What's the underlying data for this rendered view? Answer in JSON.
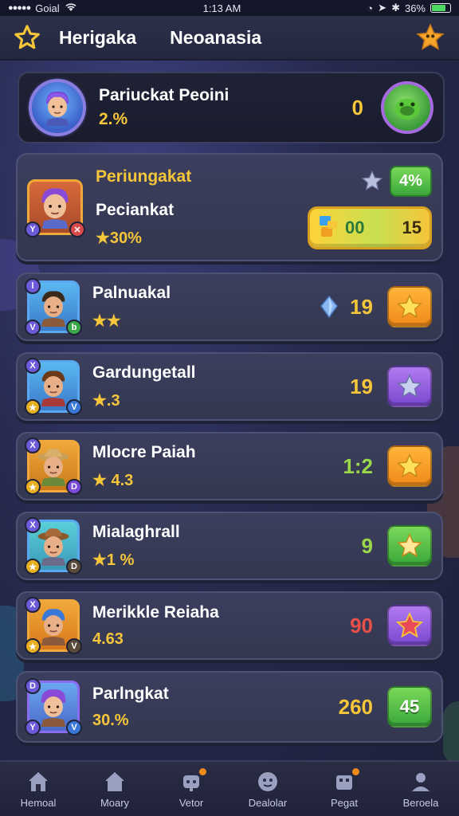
{
  "status_bar": {
    "carrier": "Goial",
    "time": "1:13 AM",
    "battery": "36%"
  },
  "header": {
    "title": "Herigaka",
    "subtitle": "Neoanasia"
  },
  "profile": {
    "name": "Pariuckat Peoini",
    "percent": "2.%",
    "score": "0"
  },
  "featured_row": {
    "title": "Periungakat",
    "name": "Peciankat",
    "rating": "★30%",
    "badge_value": "4%",
    "bar_left": "00",
    "bar_right": "15"
  },
  "rows": [
    {
      "name": "Palnuakal",
      "rating": "★★",
      "score": "19"
    },
    {
      "name": "Gardungetall",
      "rating": "★.3",
      "score": "19"
    },
    {
      "name": "Mlocre Paiah",
      "rating": "★ 4.3",
      "score": "1:2"
    },
    {
      "name": "Mialaghrall",
      "rating": "★1 %",
      "score": "9"
    },
    {
      "name": "Merikkle Reiaha",
      "rating": "4.63",
      "score": "90"
    }
  ],
  "last_row": {
    "name": "Parlngkat",
    "rating": "30.%",
    "score": "260",
    "tile_value": "45"
  },
  "nav": [
    {
      "label": "Hemoal"
    },
    {
      "label": "Moary"
    },
    {
      "label": "Vetor"
    },
    {
      "label": "Dealolar"
    },
    {
      "label": "Pegat"
    },
    {
      "label": "Beroela"
    }
  ]
}
